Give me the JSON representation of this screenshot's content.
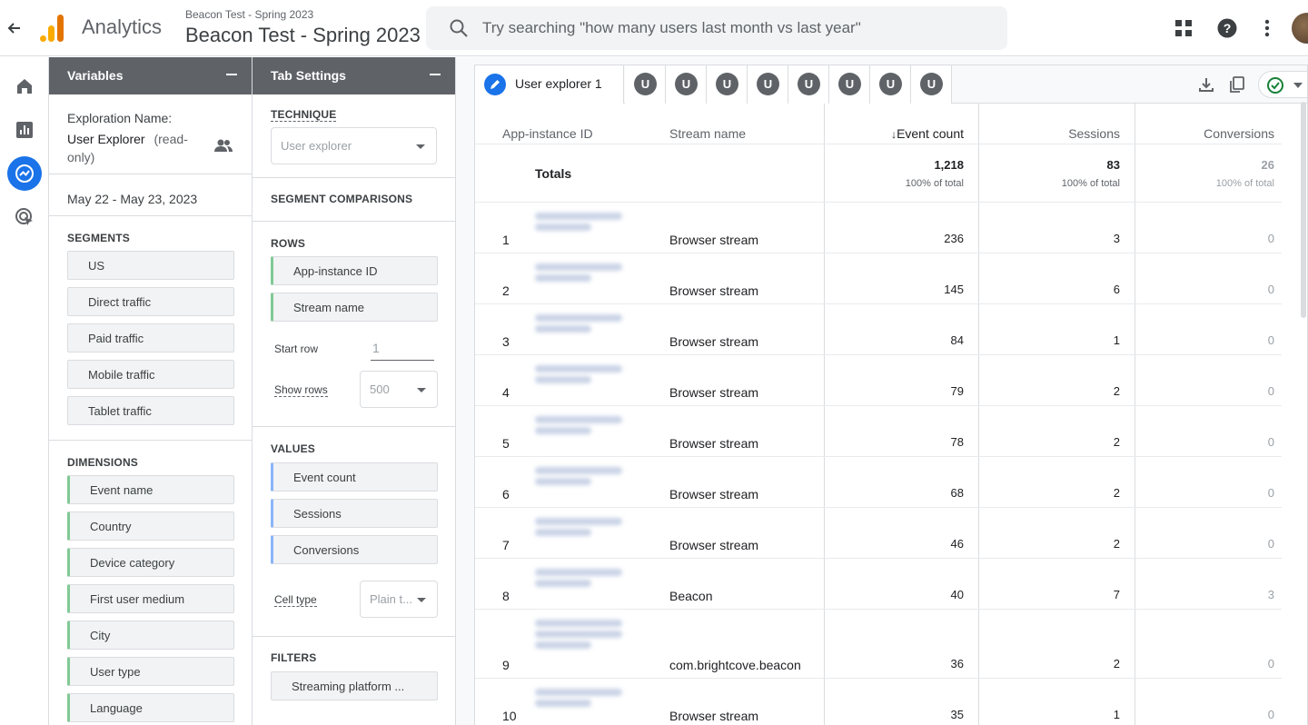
{
  "header": {
    "app_name": "Analytics",
    "property_small": "Beacon Test - Spring 2023",
    "property_big": "Beacon Test - Spring 2023",
    "search_placeholder": "Try searching \"how many users last month vs last year\""
  },
  "variables": {
    "title": "Variables",
    "exploration_name_label": "Exploration Name:",
    "exploration_name": "User Explorer",
    "read_only": "(read-only)",
    "date_range": "May 22 - May 23, 2023",
    "segments_label": "SEGMENTS",
    "segments": [
      "US",
      "Direct traffic",
      "Paid traffic",
      "Mobile traffic",
      "Tablet traffic"
    ],
    "dimensions_label": "DIMENSIONS",
    "dimensions": [
      "Event name",
      "Country",
      "Device category",
      "First user medium",
      "City",
      "User type",
      "Language"
    ]
  },
  "tab_settings": {
    "title": "Tab Settings",
    "technique_label": "TECHNIQUE",
    "technique_value": "User explorer",
    "segment_comparisons_label": "SEGMENT COMPARISONS",
    "rows_label": "ROWS",
    "rows": [
      "App-instance ID",
      "Stream name"
    ],
    "start_row_label": "Start row",
    "start_row_value": "1",
    "show_rows_label": "Show rows",
    "show_rows_value": "500",
    "values_label": "VALUES",
    "values": [
      "Event count",
      "Sessions",
      "Conversions"
    ],
    "cell_type_label": "Cell type",
    "cell_type_value": "Plain t...",
    "filters_label": "FILTERS",
    "filter_value": "Streaming platform ..."
  },
  "tabs": {
    "active_label": "User explorer 1",
    "user_tabs": [
      "U",
      "U",
      "U",
      "U",
      "U",
      "U",
      "U",
      "U"
    ]
  },
  "table": {
    "headers": {
      "id": "App-instance ID",
      "stream": "Stream name",
      "events": "Event count",
      "sessions": "Sessions",
      "conversions": "Conversions"
    },
    "totals": {
      "label": "Totals",
      "events": "1,218",
      "events_pct": "100% of total",
      "sessions": "83",
      "sessions_pct": "100% of total",
      "conversions": "26",
      "conversions_pct": "100% of total"
    },
    "rows": [
      {
        "n": "1",
        "stream": "Browser stream",
        "events": "236",
        "sessions": "3",
        "conversions": "0"
      },
      {
        "n": "2",
        "stream": "Browser stream",
        "events": "145",
        "sessions": "6",
        "conversions": "0"
      },
      {
        "n": "3",
        "stream": "Browser stream",
        "events": "84",
        "sessions": "1",
        "conversions": "0"
      },
      {
        "n": "4",
        "stream": "Browser stream",
        "events": "79",
        "sessions": "2",
        "conversions": "0"
      },
      {
        "n": "5",
        "stream": "Browser stream",
        "events": "78",
        "sessions": "2",
        "conversions": "0"
      },
      {
        "n": "6",
        "stream": "Browser stream",
        "events": "68",
        "sessions": "2",
        "conversions": "0"
      },
      {
        "n": "7",
        "stream": "Browser stream",
        "events": "46",
        "sessions": "2",
        "conversions": "0"
      },
      {
        "n": "8",
        "stream": "Beacon",
        "events": "40",
        "sessions": "7",
        "conversions": "3"
      },
      {
        "n": "9",
        "stream": "com.brightcove.beacon",
        "events": "36",
        "sessions": "2",
        "conversions": "0"
      },
      {
        "n": "10",
        "stream": "Browser stream",
        "events": "35",
        "sessions": "1",
        "conversions": "0"
      }
    ]
  }
}
